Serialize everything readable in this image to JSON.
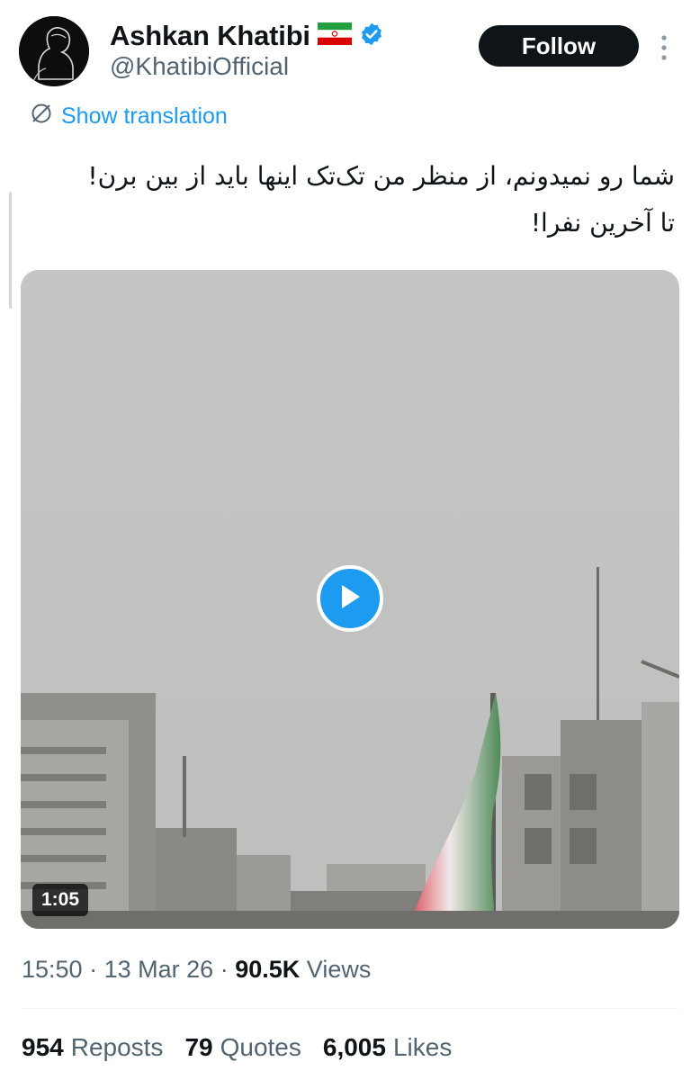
{
  "author": {
    "name": "Ashkan Khatibi",
    "handle": "@KhatibiOfficial",
    "flag_icon": "iran-flag-icon",
    "verified_icon": "verified-badge-icon"
  },
  "actions": {
    "follow_label": "Follow",
    "more_icon": "more-vertical-icon"
  },
  "translation": {
    "label": "Show translation",
    "icon": "globe-slash-icon"
  },
  "tweet": {
    "line1": "شما رو نمیدونم، از منظر من تک‌تک اینها باید از بین برن!",
    "line2": "تا آخرین نفرا!"
  },
  "media": {
    "type": "video",
    "duration": "1:05",
    "play_icon": "play-icon"
  },
  "meta": {
    "time": "15:50",
    "separator": "·",
    "date": "13 Mar 26",
    "views_count": "90.5K",
    "views_label": "Views"
  },
  "stats": {
    "reposts_count": "954",
    "reposts_label": "Reposts",
    "quotes_count": "79",
    "quotes_label": "Quotes",
    "likes_count": "6,005",
    "likes_label": "Likes"
  },
  "colors": {
    "accent": "#1d9bf0",
    "text_primary": "#0f1419",
    "text_secondary": "#536471",
    "follow_bg": "#0f1419"
  }
}
